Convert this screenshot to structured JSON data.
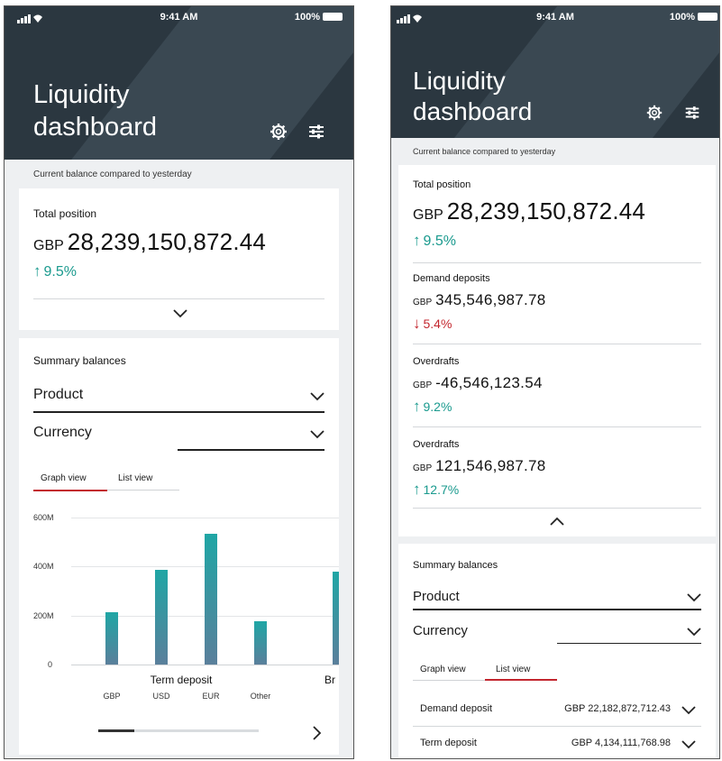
{
  "status": {
    "time": "9:41 AM",
    "battery": "100%"
  },
  "title_line1": "Liquidity",
  "title_line2": "dashboard",
  "subtitle": "Current balance compared to yesterday",
  "total": {
    "label": "Total position",
    "currency": "GBP",
    "value": "28,239,150,872.44",
    "change": "9.5%",
    "direction": "up"
  },
  "summary": {
    "heading": "Summary balances",
    "product_label": "Product",
    "currency_label": "Currency",
    "tab_graph": "Graph view",
    "tab_list": "List view"
  },
  "details": [
    {
      "label": "Demand deposits",
      "currency": "GBP",
      "value": "345,546,987.78",
      "change": "5.4%",
      "direction": "down"
    },
    {
      "label": "Overdrafts",
      "currency": "GBP",
      "value": "-46,546,123.54",
      "change": "9.2%",
      "direction": "up"
    },
    {
      "label": "Overdrafts",
      "currency": "GBP",
      "value": "121,546,987.78",
      "change": "12.7%",
      "direction": "up"
    }
  ],
  "chart_data": {
    "type": "bar",
    "y_ticks": [
      "600M",
      "400M",
      "200M",
      "0"
    ],
    "ylim": [
      0,
      600
    ],
    "group_label": "Term deposit",
    "next_group_label_partial": "Br",
    "categories": [
      "GBP",
      "USD",
      "EUR",
      "Other"
    ],
    "values": [
      215,
      385,
      535,
      175
    ],
    "next_group_first_value": 380,
    "grid": true
  },
  "list": [
    {
      "name": "Demand deposit",
      "value": "GBP 22,182,872,712.43"
    },
    {
      "name": "Term deposit",
      "value": "GBP 4,134,111,768.98"
    }
  ],
  "colors": {
    "header": "#2b3740",
    "teal": "#1a9a8e",
    "red": "#c3262e",
    "active_tab": "#c3262e"
  }
}
